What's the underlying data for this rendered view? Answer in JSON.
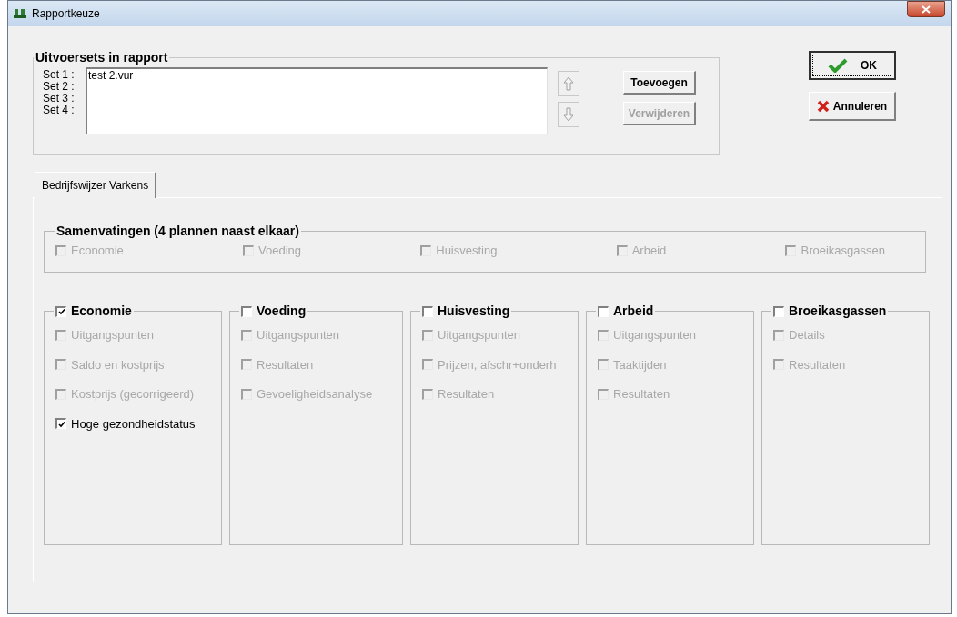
{
  "window": {
    "title": "Rapportkeuze"
  },
  "output_sets": {
    "title": "Uitvoersets in rapport",
    "set_labels": [
      "Set 1 :",
      "Set 2 :",
      "Set 3 :",
      "Set 4 :"
    ],
    "list_items": [
      "test 2.vur"
    ],
    "move_up_disabled": true,
    "move_down_disabled": true,
    "buttons": [
      {
        "label": "Toevoegen",
        "disabled": false
      },
      {
        "label": "Verwijderen",
        "disabled": true
      }
    ]
  },
  "dialog_buttons": [
    {
      "label": "OK",
      "kind": "ok",
      "default": true
    },
    {
      "label": "Annuleren",
      "kind": "cancel",
      "default": false
    }
  ],
  "tabs": [
    {
      "label": "Bedrijfswijzer Varkens",
      "selected": true
    }
  ],
  "summaries": {
    "title": "Samenvatingen (4 plannen naast elkaar)",
    "options": [
      {
        "label": "Economie",
        "checked": false,
        "disabled": true
      },
      {
        "label": "Voeding",
        "checked": false,
        "disabled": true
      },
      {
        "label": "Huisvesting",
        "checked": false,
        "disabled": true
      },
      {
        "label": "Arbeid",
        "checked": false,
        "disabled": true
      },
      {
        "label": "Broeikasgassen",
        "checked": false,
        "disabled": true
      }
    ]
  },
  "sections": [
    {
      "title": "Economie",
      "checked": true,
      "options": [
        {
          "label": "Uitgangspunten",
          "checked": false,
          "disabled": true
        },
        {
          "label": "Saldo en kostprijs",
          "checked": false,
          "disabled": true
        },
        {
          "label": "Kostprijs (gecorrigeerd)",
          "checked": false,
          "disabled": true
        },
        {
          "label": "Hoge gezondheidstatus",
          "checked": true,
          "disabled": false
        }
      ]
    },
    {
      "title": "Voeding",
      "checked": false,
      "options": [
        {
          "label": "Uitgangspunten",
          "checked": false,
          "disabled": true
        },
        {
          "label": "Resultaten",
          "checked": false,
          "disabled": true
        },
        {
          "label": "Gevoeligheidsanalyse",
          "checked": false,
          "disabled": true
        }
      ]
    },
    {
      "title": "Huisvesting",
      "checked": false,
      "options": [
        {
          "label": "Uitgangspunten",
          "checked": false,
          "disabled": true
        },
        {
          "label": "Prijzen, afschr+onderh",
          "checked": false,
          "disabled": true
        },
        {
          "label": "Resultaten",
          "checked": false,
          "disabled": true
        }
      ]
    },
    {
      "title": "Arbeid",
      "checked": false,
      "options": [
        {
          "label": "Uitgangspunten",
          "checked": false,
          "disabled": true
        },
        {
          "label": "Taaktijden",
          "checked": false,
          "disabled": true
        },
        {
          "label": "Resultaten",
          "checked": false,
          "disabled": true
        }
      ]
    },
    {
      "title": "Broeikasgassen",
      "checked": false,
      "options": [
        {
          "label": "Details",
          "checked": false,
          "disabled": true
        },
        {
          "label": "Resultaten",
          "checked": false,
          "disabled": true
        }
      ]
    }
  ]
}
